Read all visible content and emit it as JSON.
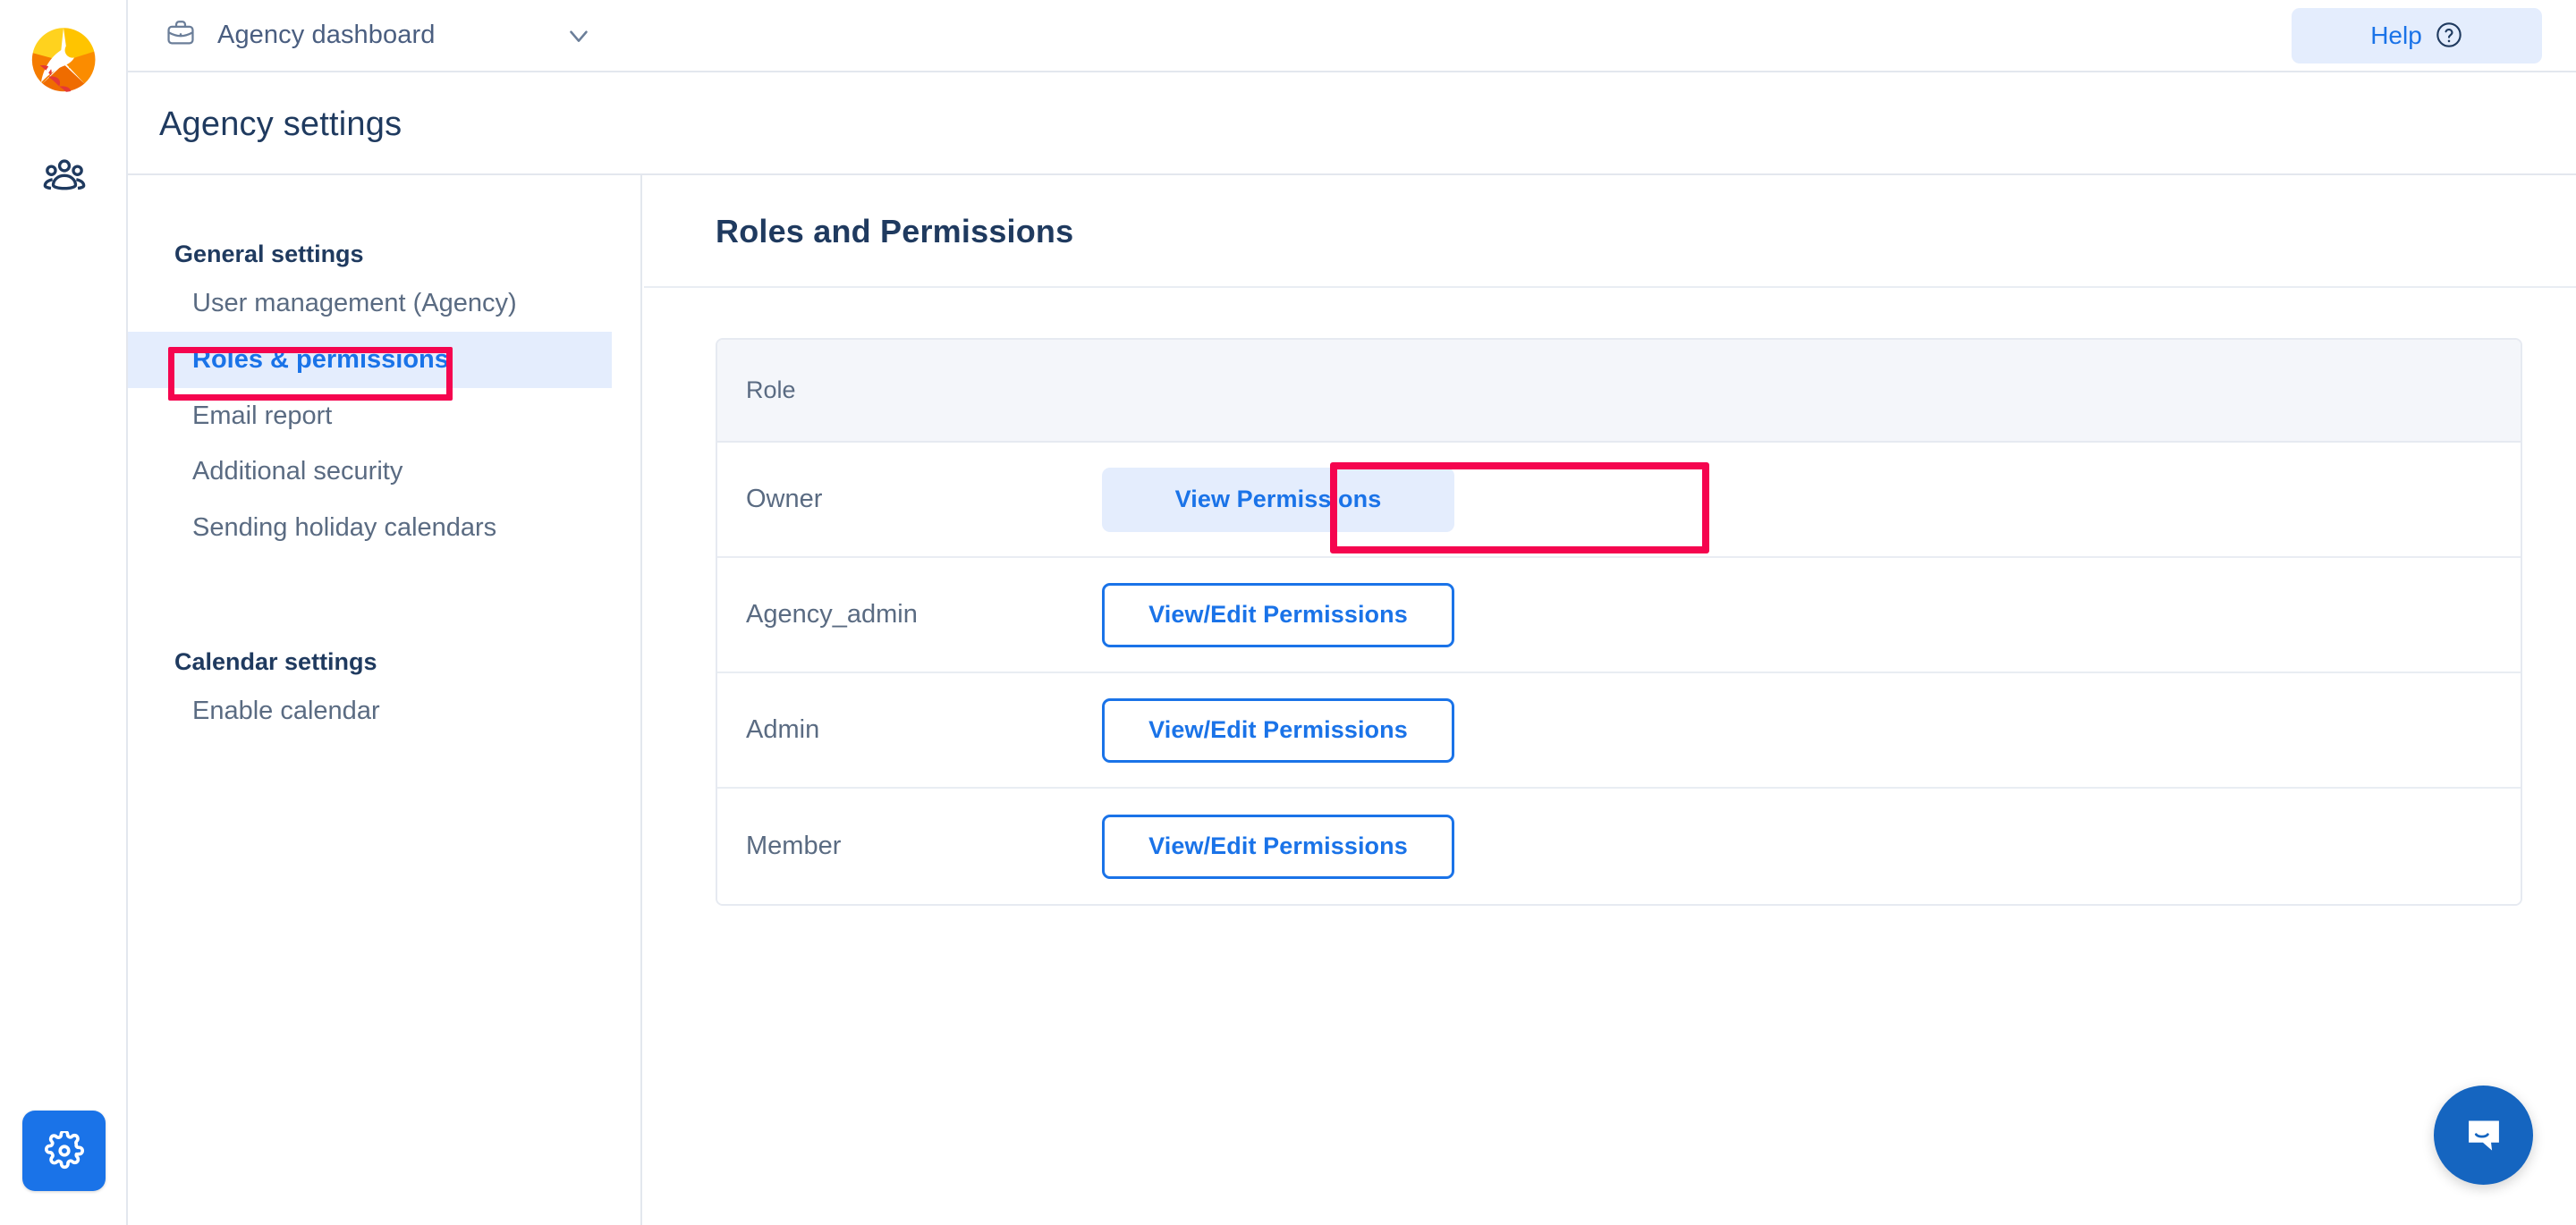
{
  "rail": {
    "logo_name": "app-logo",
    "nav_icon_label": "users-icon",
    "settings_button_label": "settings-gear"
  },
  "topbar": {
    "workspace_icon": "briefcase-icon",
    "workspace_name": "Agency dashboard",
    "chevron_icon": "chevron-down-icon",
    "help_label": "Help",
    "help_icon": "question-circle-icon"
  },
  "page": {
    "title": "Agency settings"
  },
  "settings_nav": {
    "groups": [
      {
        "title": "General settings",
        "items": [
          {
            "label": "User management (Agency)",
            "active": false
          },
          {
            "label": "Roles & permissions",
            "active": true
          },
          {
            "label": "Email report",
            "active": false
          },
          {
            "label": "Additional security",
            "active": false
          },
          {
            "label": "Sending holiday calendars",
            "active": false
          }
        ]
      },
      {
        "title": "Calendar settings",
        "items": [
          {
            "label": "Enable calendar",
            "active": false
          }
        ]
      }
    ]
  },
  "main": {
    "section_title": "Roles and Permissions",
    "table": {
      "columns": [
        "Role",
        ""
      ],
      "rows": [
        {
          "role": "Owner",
          "action_label": "View Permissions",
          "style": "filled",
          "highlighted": true
        },
        {
          "role": "Agency_admin",
          "action_label": "View/Edit Permissions",
          "style": "outline",
          "highlighted": false
        },
        {
          "role": "Admin",
          "action_label": "View/Edit Permissions",
          "style": "outline",
          "highlighted": false
        },
        {
          "role": "Member",
          "action_label": "View/Edit Permissions",
          "style": "outline",
          "highlighted": false
        }
      ]
    }
  },
  "chat": {
    "icon": "chat-bubble-icon"
  },
  "colors": {
    "accent_blue": "#1a73e8",
    "highlight_red": "#f5054f",
    "text_navy": "#1f3a5f",
    "text_gray": "#5a6b82",
    "table_header_bg": "#f4f6fa",
    "soft_blue_bg": "#e4edfd"
  }
}
